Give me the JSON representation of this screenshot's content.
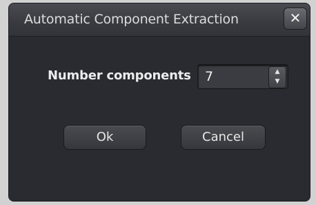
{
  "dialog": {
    "title": "Automatic Component Extraction",
    "close_symbol": "✕"
  },
  "form": {
    "number_components_label": "Number components",
    "number_components_value": "7",
    "spin_up": "▲",
    "spin_down": "▼"
  },
  "buttons": {
    "ok_label": "Ok",
    "cancel_label": "Cancel"
  }
}
